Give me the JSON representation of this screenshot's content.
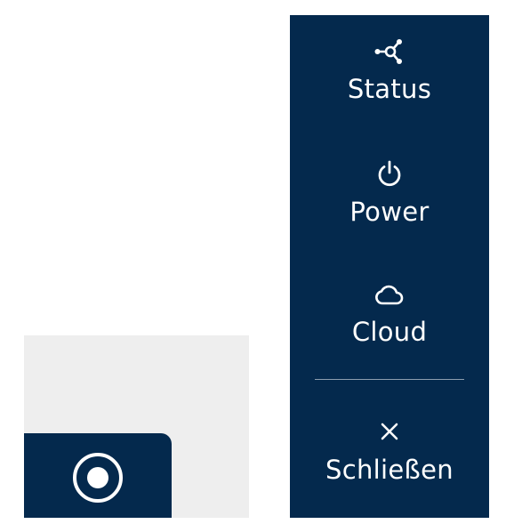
{
  "menu": {
    "items": [
      {
        "id": "status",
        "label": "Status",
        "icon": "network-hub-icon"
      },
      {
        "id": "power",
        "label": "Power",
        "icon": "power-icon"
      },
      {
        "id": "cloud",
        "label": "Cloud",
        "icon": "cloud-icon"
      }
    ],
    "close": {
      "label": "Schließen",
      "icon": "close-icon"
    }
  },
  "colors": {
    "panel": "#04294d",
    "text": "#ffffff",
    "background_gray": "#eeeeee"
  },
  "fab": {
    "icon": "radio-target-icon"
  }
}
